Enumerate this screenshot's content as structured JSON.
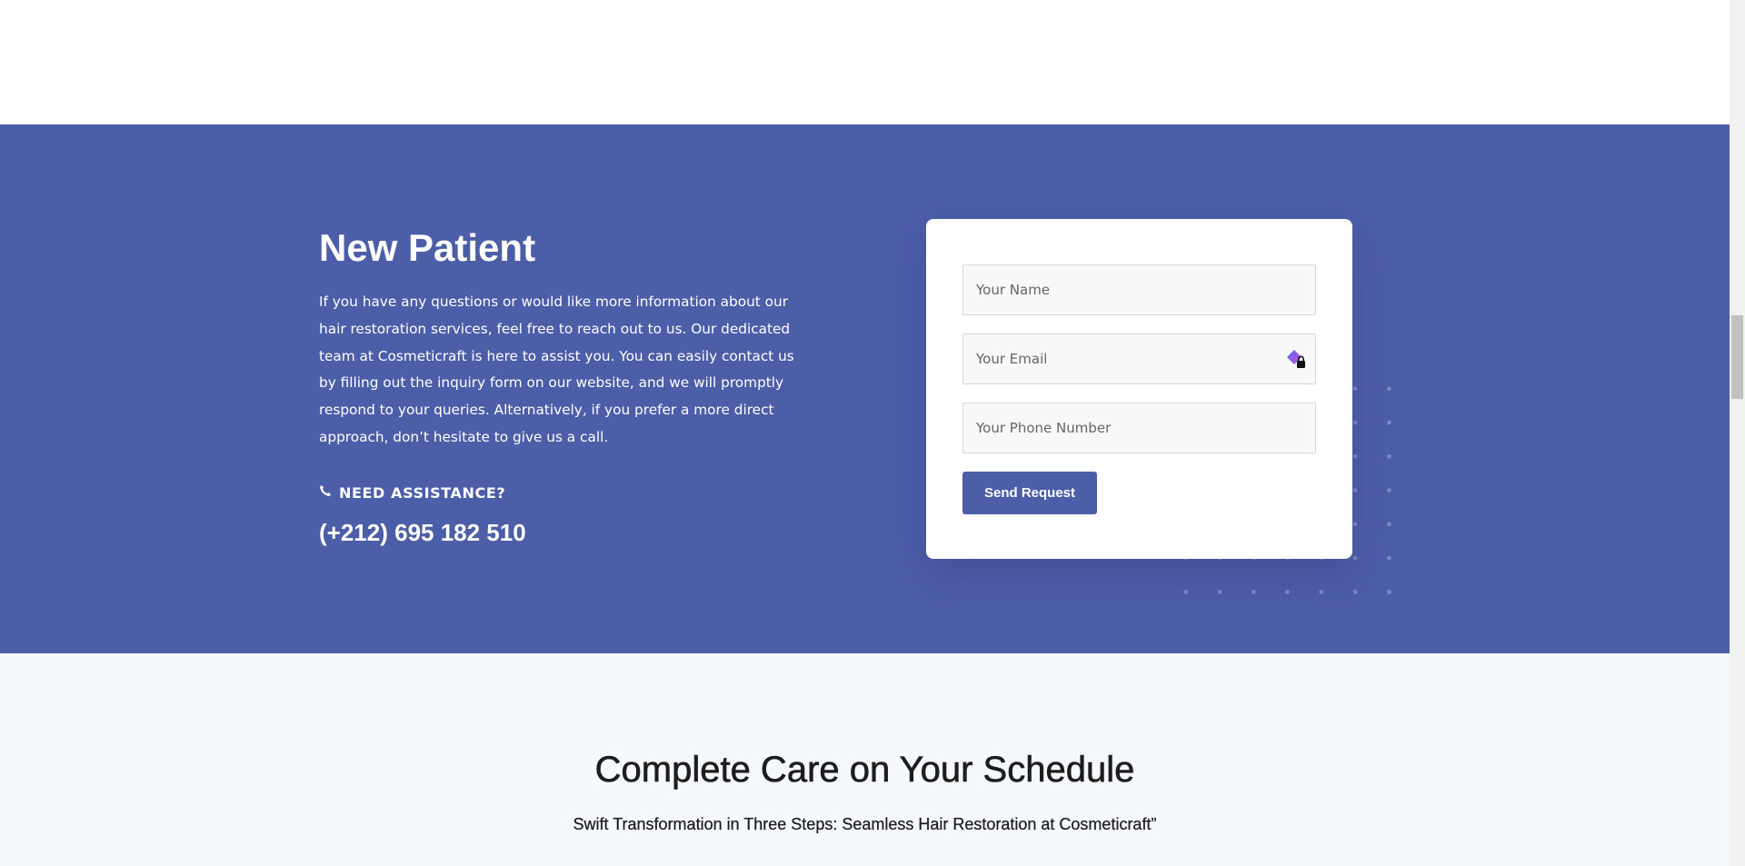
{
  "cta": {
    "title": "New Patient",
    "description": "If you have any questions or would like more information about our hair restoration services, feel free to reach out to us. Our dedicated team at Cosmeticraft is here to assist you. You can easily contact us by filling out the inquiry form on our website, and we will promptly respond to your queries. Alternatively, if you prefer a more direct approach, don’t hesitate to give us a call.",
    "assistance_label": "NEED ASSISTANCE?",
    "phone": "(+212) 695 182 510",
    "icons": {
      "phone": "phone-icon"
    }
  },
  "form": {
    "name_placeholder": "Your Name",
    "email_placeholder": "Your Email",
    "phone_placeholder": "Your Phone Number",
    "submit_label": "Send Request",
    "icons": {
      "email_field": "password-manager-icon"
    }
  },
  "care": {
    "title": "Complete Care on Your Schedule",
    "subtitle": "Swift Transformation in Three Steps: Seamless Hair Restoration at Cosmeticraft”"
  },
  "colors": {
    "primary": "#4d5ea9",
    "section_light": "#f5f8fc",
    "white": "#ffffff",
    "heading_dark": "#1d1d1d"
  }
}
